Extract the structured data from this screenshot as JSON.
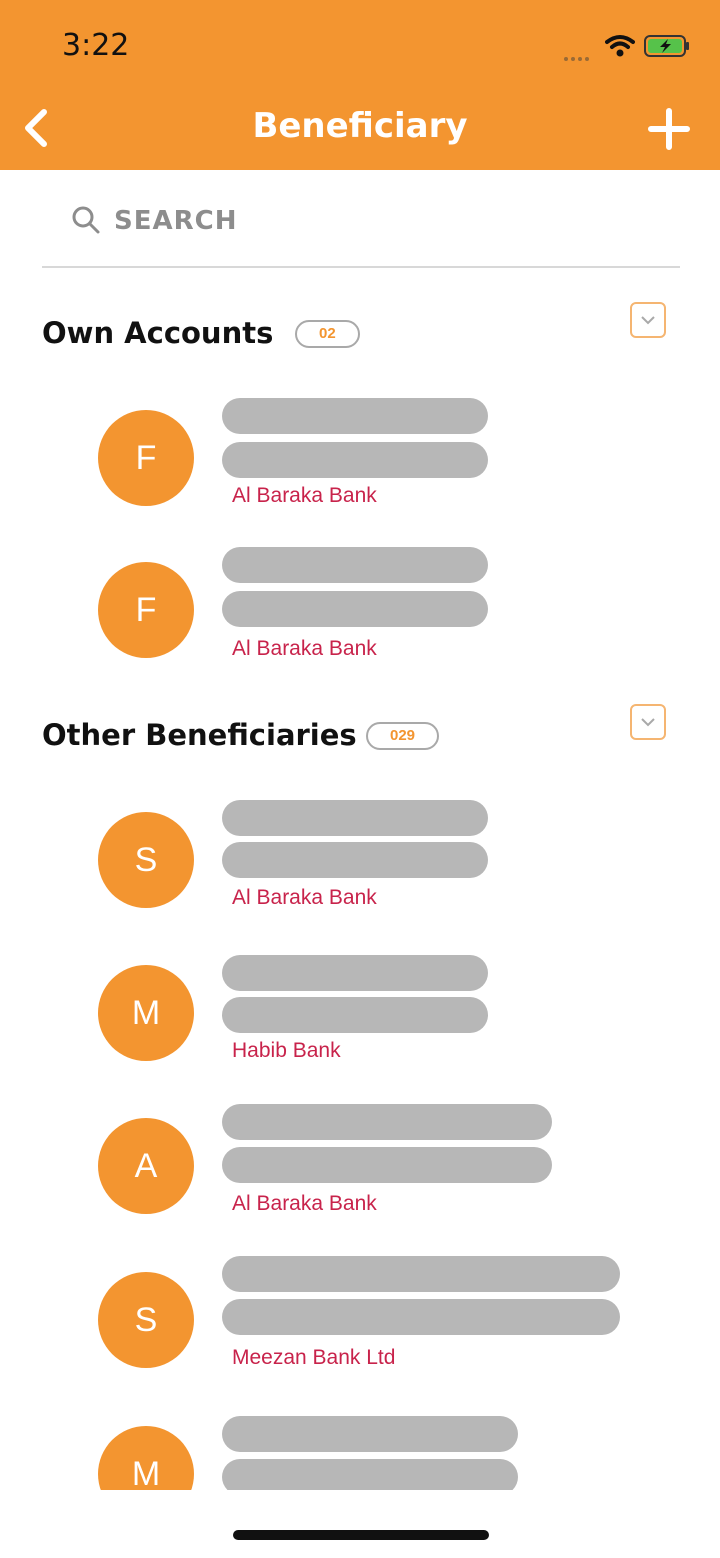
{
  "status_bar": {
    "time": "3:22"
  },
  "header": {
    "title": "Beneficiary"
  },
  "search": {
    "placeholder": "SEARCH"
  },
  "sections": [
    {
      "title": "Own Accounts",
      "count": "02",
      "items": [
        {
          "initial": "F",
          "bank": "Al Baraka Bank"
        },
        {
          "initial": "F",
          "bank": "Al Baraka Bank"
        }
      ]
    },
    {
      "title": "Other Beneficiaries",
      "count": "029",
      "items": [
        {
          "initial": "S",
          "bank": "Al Baraka Bank"
        },
        {
          "initial": "M",
          "bank": "Habib Bank"
        },
        {
          "initial": "A",
          "bank": "Al Baraka Bank"
        },
        {
          "initial": "S",
          "bank": "Meezan Bank Ltd"
        },
        {
          "initial": "M",
          "bank": ""
        }
      ]
    }
  ],
  "icons": [
    "back-chevron-icon",
    "plus-icon",
    "search-icon",
    "chevron-down-icon",
    "wifi-icon",
    "battery-charging-icon"
  ],
  "colors": {
    "brand": "#f39530",
    "bank_text": "#c8234b",
    "redacted": "#b7b7b7"
  }
}
